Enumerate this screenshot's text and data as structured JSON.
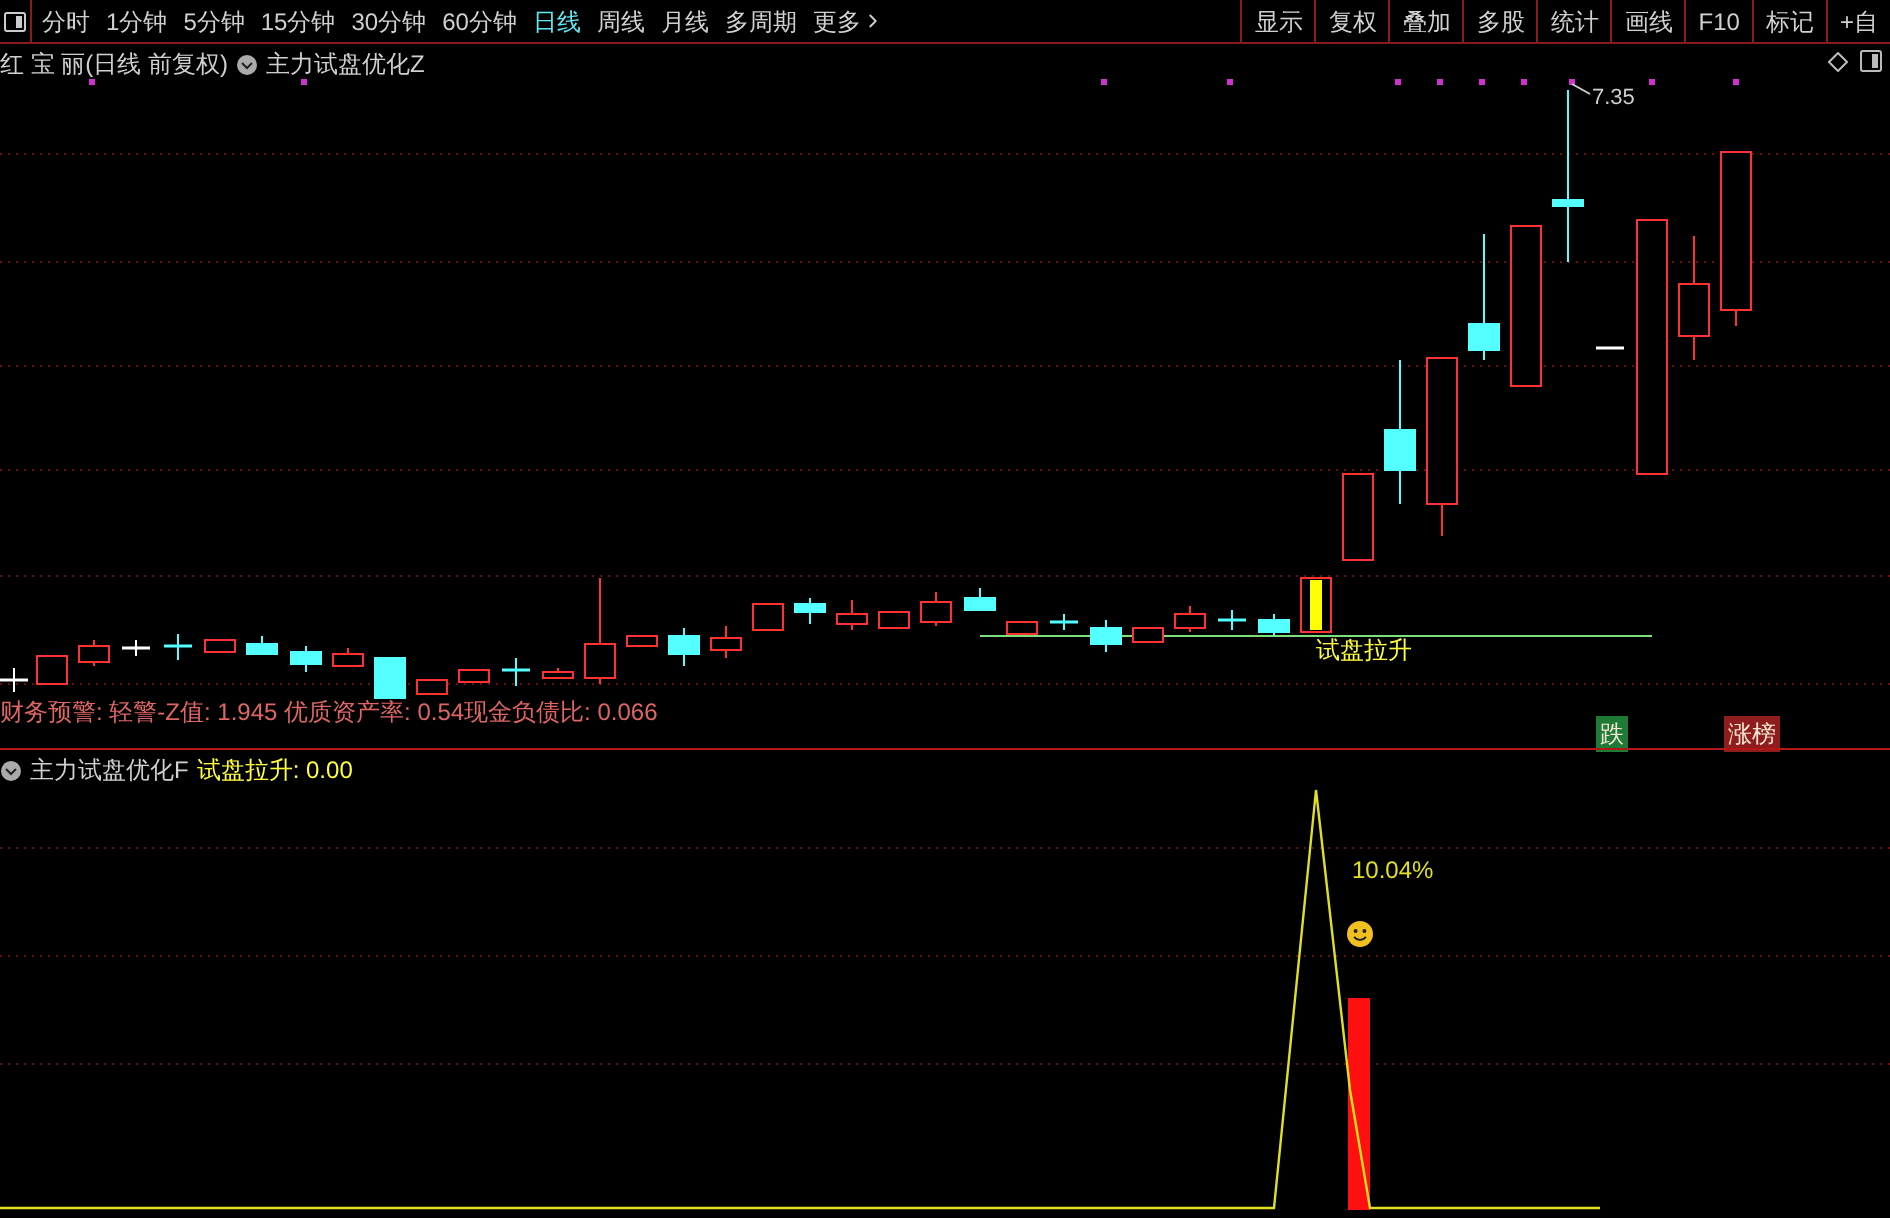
{
  "toolbar": {
    "periods": [
      {
        "label": "分时",
        "selected": false
      },
      {
        "label": "1分钟",
        "selected": false
      },
      {
        "label": "5分钟",
        "selected": false
      },
      {
        "label": "15分钟",
        "selected": false
      },
      {
        "label": "30分钟",
        "selected": false
      },
      {
        "label": "60分钟",
        "selected": false
      },
      {
        "label": "日线",
        "selected": true
      },
      {
        "label": "周线",
        "selected": false
      },
      {
        "label": "月线",
        "selected": false
      },
      {
        "label": "多周期",
        "selected": false
      }
    ],
    "more": "更多",
    "tools": [
      "显示",
      "复权",
      "叠加",
      "多股",
      "统计",
      "画线",
      "F10",
      "标记",
      "+自"
    ]
  },
  "main_chart": {
    "title": "红 宝 丽(日线 前复权)",
    "indicator": "主力试盘优化Z",
    "high_label": "7.35",
    "signal_label": "试盘拉升",
    "finance_line": "财务预警: 轻警-Z值: 1.945 优质资产率: 0.54现金负债比: 0.066",
    "badges": [
      {
        "text": "跌",
        "color": "#1f7a35"
      },
      {
        "text": "涨榜",
        "color": "#8f1d1d"
      }
    ]
  },
  "sub_chart": {
    "indicator": "主力试盘优化F",
    "value_label": "试盘拉升: 0.00",
    "peak_label": "10.04%"
  }
}
